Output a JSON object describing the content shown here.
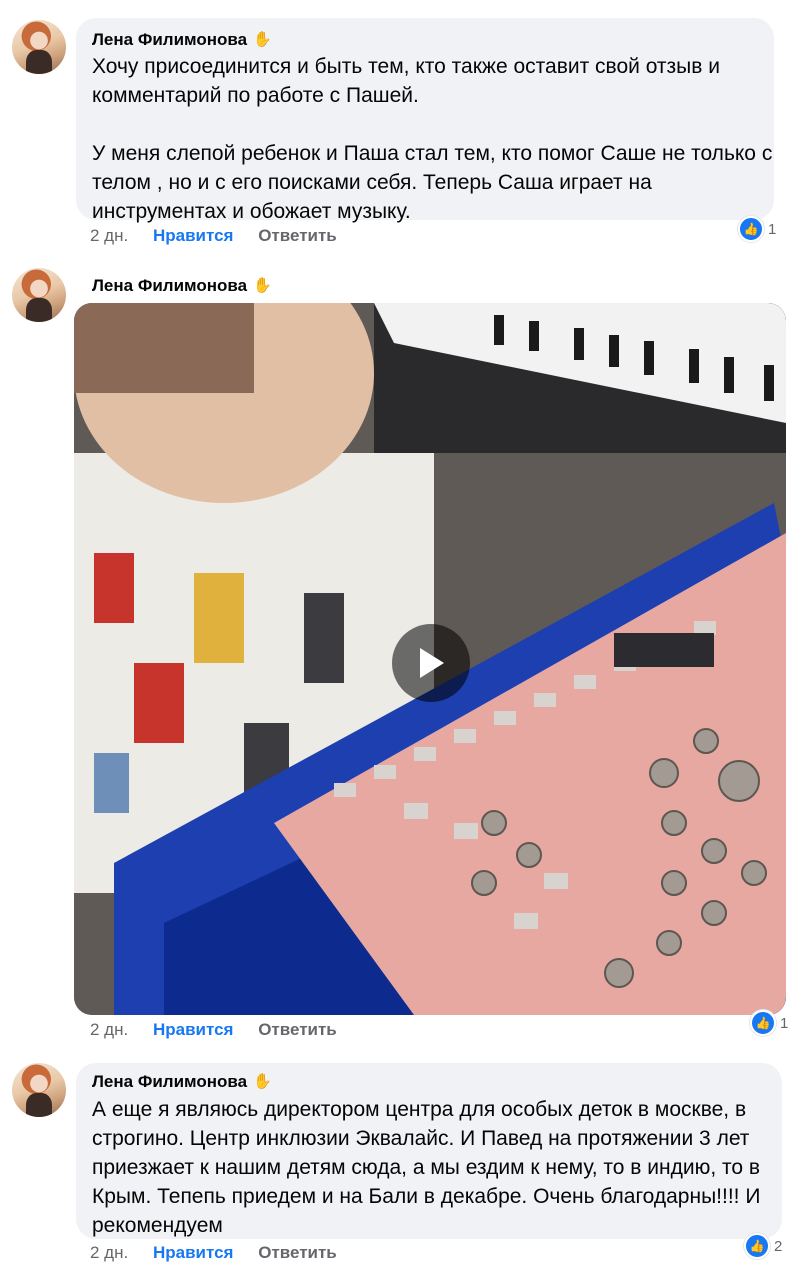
{
  "comments": [
    {
      "author": "Лена Филимонова",
      "badge_icon": "✋",
      "paragraphs": [
        "Хочу присоединится и быть тем, кто также оставит свой отзыв и комментарий по работе с Пашей.",
        "У меня слепой ребенок и Паша стал тем, кто помог Саше не только с телом , но и с его поисками себя. Теперь Саша играет на инструментах и обожает музыку."
      ],
      "time": "2 дн.",
      "like_label": "Нравится",
      "reply_label": "Ответить",
      "reaction_count": "1"
    },
    {
      "author": "Лена Филимонова",
      "badge_icon": "✋",
      "media": "video",
      "time": "2 дн.",
      "like_label": "Нравится",
      "reply_label": "Ответить",
      "reaction_count": "1"
    },
    {
      "author": "Лена Филимонова",
      "badge_icon": "✋",
      "paragraphs": [
        "А еще я являюсь директором центра для особых деток в москве, в строгино. Центр инклюзии Эквалайс. И Павед на протяжении 3 лет приезжает к нашим детям сюда, а мы ездим к нему, то в индию, то в Крым. Тепепь приедем и на Бали в декабре.  Очень благодарны!!!! И рекомендуем"
      ],
      "time": "2 дн.",
      "like_label": "Нравится",
      "reply_label": "Ответить",
      "reaction_count": "2"
    }
  ],
  "icons": {
    "reaction": "like-thumb-icon",
    "play": "play-icon"
  },
  "colors": {
    "bubble": "#f0f2f5",
    "like_active": "#1877f2",
    "meta": "#65676b"
  }
}
